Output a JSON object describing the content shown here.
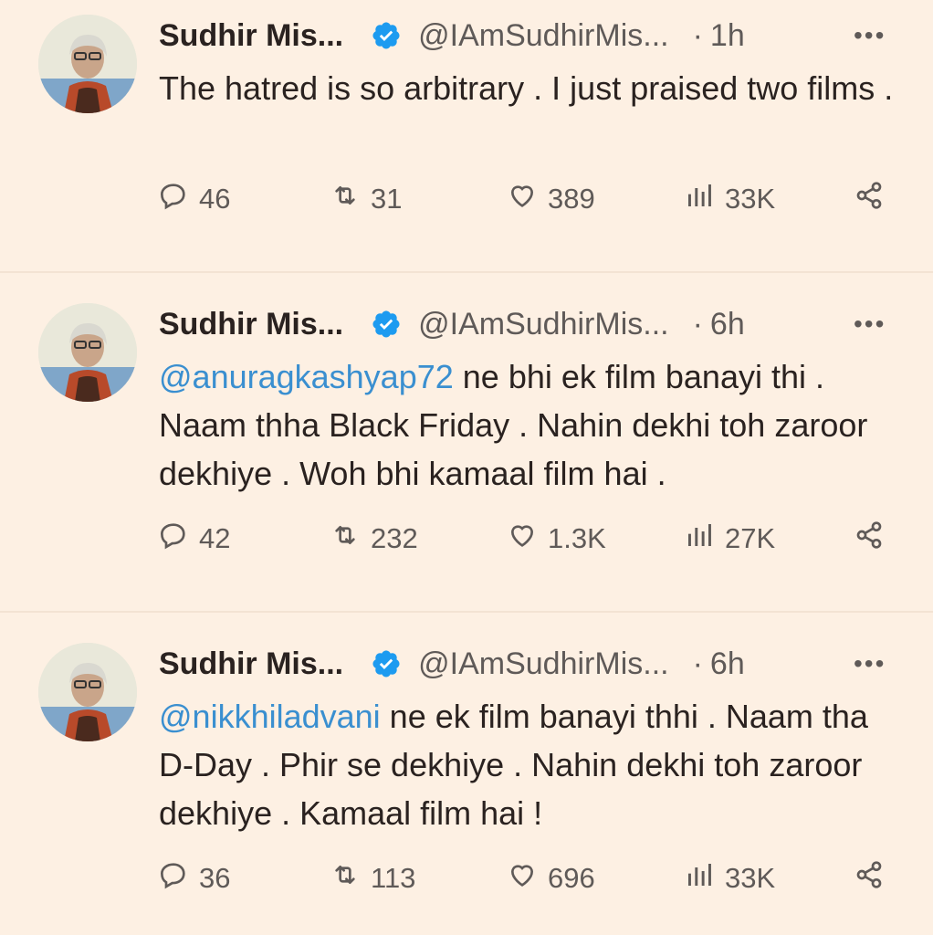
{
  "tweets": [
    {
      "name": "Sudhir Mis...",
      "handle": "@IAmSudhirMis...",
      "dot": "·",
      "time": "1h",
      "more": "•••",
      "text_plain": "The hatred is so arbitrary . I just praised two films .",
      "mention": "",
      "text_rest": "",
      "replies": "46",
      "retweets": "31",
      "likes": "389",
      "views": "33K",
      "icons": {
        "reply": "reply-icon",
        "retweet": "retweet-icon",
        "like": "heart-icon",
        "views": "views-icon",
        "share": "share-icon"
      }
    },
    {
      "name": "Sudhir Mis...",
      "handle": "@IAmSudhirMis...",
      "dot": "·",
      "time": "6h",
      "more": "•••",
      "text_plain": "",
      "mention": "@anuragkashyap72",
      "text_rest": " ne bhi ek film banayi thi . Naam thha Black Friday . Nahin dekhi toh zaroor dekhiye . Woh bhi kamaal film hai .",
      "replies": "42",
      "retweets": "232",
      "likes": "1.3K",
      "views": "27K",
      "icons": {
        "reply": "reply-icon",
        "retweet": "retweet-icon",
        "like": "heart-icon",
        "views": "views-icon",
        "share": "share-icon"
      }
    },
    {
      "name": "Sudhir Mis...",
      "handle": "@IAmSudhirMis...",
      "dot": "·",
      "time": "6h",
      "more": "•••",
      "text_plain": "",
      "mention": "@nikkhiladvani",
      "text_rest": " ne ek film banayi thhi . Naam tha D-Day . Phir se dekhiye . Nahin dekhi toh zaroor dekhiye . Kamaal film hai !",
      "replies": "36",
      "retweets": "113",
      "likes": "696",
      "views": "33K",
      "icons": {
        "reply": "reply-icon",
        "retweet": "retweet-icon",
        "like": "heart-icon",
        "views": "views-icon",
        "share": "share-icon"
      }
    }
  ],
  "colors": {
    "background": "#fdf0e3",
    "text": "#2a2220",
    "muted": "#5f5a58",
    "mention": "#3a8fd0",
    "verified": "#1d9bf0",
    "divider": "#f3e3d3"
  }
}
